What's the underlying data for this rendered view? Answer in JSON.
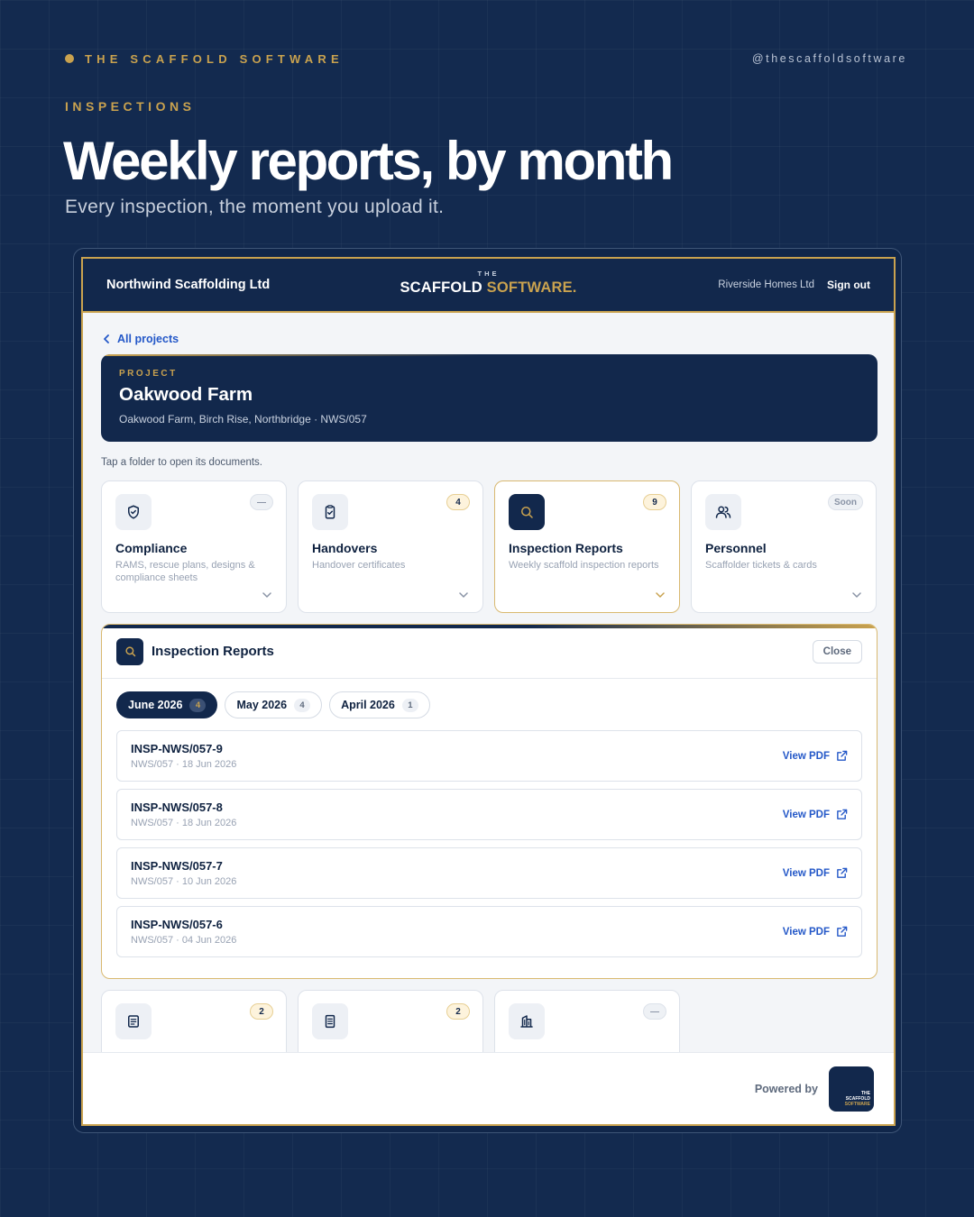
{
  "brand": {
    "name": "THE SCAFFOLD SOFTWARE",
    "handle": "@thescaffoldsoftware"
  },
  "hero": {
    "eyebrow": "INSPECTIONS",
    "headline": "Weekly reports, by month",
    "subline": "Every inspection, the moment you upload it."
  },
  "app": {
    "company": "Northwind Scaffolding Ltd",
    "logo_the": "THE",
    "logo_scaffold": "SCAFFOLD",
    "logo_software": "SOFTWARE.",
    "client": "Riverside Homes Ltd",
    "signout": "Sign out"
  },
  "nav": {
    "back_label": "All projects"
  },
  "project": {
    "label": "PROJECT",
    "title": "Oakwood Farm",
    "subtitle": "Oakwood Farm, Birch Rise, Northbridge · NWS/057"
  },
  "hint": "Tap a folder to open its documents.",
  "folders": [
    {
      "title": "Compliance",
      "desc": "RAMS, rescue plans, designs & compliance sheets",
      "badge": "—",
      "icon": "shield-check-icon"
    },
    {
      "title": "Handovers",
      "desc": "Handover certificates",
      "badge": "4",
      "icon": "clipboard-check-icon"
    },
    {
      "title": "Inspection Reports",
      "desc": "Weekly scaffold inspection reports",
      "badge": "9",
      "icon": "search-icon"
    },
    {
      "title": "Personnel",
      "desc": "Scaffolder tickets & cards",
      "badge": "Soon",
      "icon": "users-icon"
    }
  ],
  "panel": {
    "title": "Inspection Reports",
    "close_label": "Close",
    "tabs": [
      {
        "label": "June 2026",
        "count": "4"
      },
      {
        "label": "May 2026",
        "count": "4"
      },
      {
        "label": "April 2026",
        "count": "1"
      }
    ],
    "reports": [
      {
        "id": "INSP-NWS/057-9",
        "meta": "NWS/057 · 18 Jun 2026",
        "action": "View PDF"
      },
      {
        "id": "INSP-NWS/057-8",
        "meta": "NWS/057 · 18 Jun 2026",
        "action": "View PDF"
      },
      {
        "id": "INSP-NWS/057-7",
        "meta": "NWS/057 · 10 Jun 2026",
        "action": "View PDF"
      },
      {
        "id": "INSP-NWS/057-6",
        "meta": "NWS/057 · 04 Jun 2026",
        "action": "View PDF"
      }
    ]
  },
  "folders_lower": [
    {
      "badge": "2",
      "icon": "document-list-icon"
    },
    {
      "badge": "2",
      "icon": "document-icon"
    },
    {
      "badge": "—",
      "icon": "building-icon"
    }
  ],
  "footer": {
    "powered_by": "Powered by",
    "mini_logo": [
      "THE",
      "SCAFFOLD",
      "SOFTWARE"
    ]
  },
  "colors": {
    "navy": "#12284c",
    "gold": "#c9a24f",
    "link": "#2458c8",
    "background": "#132a4f"
  }
}
